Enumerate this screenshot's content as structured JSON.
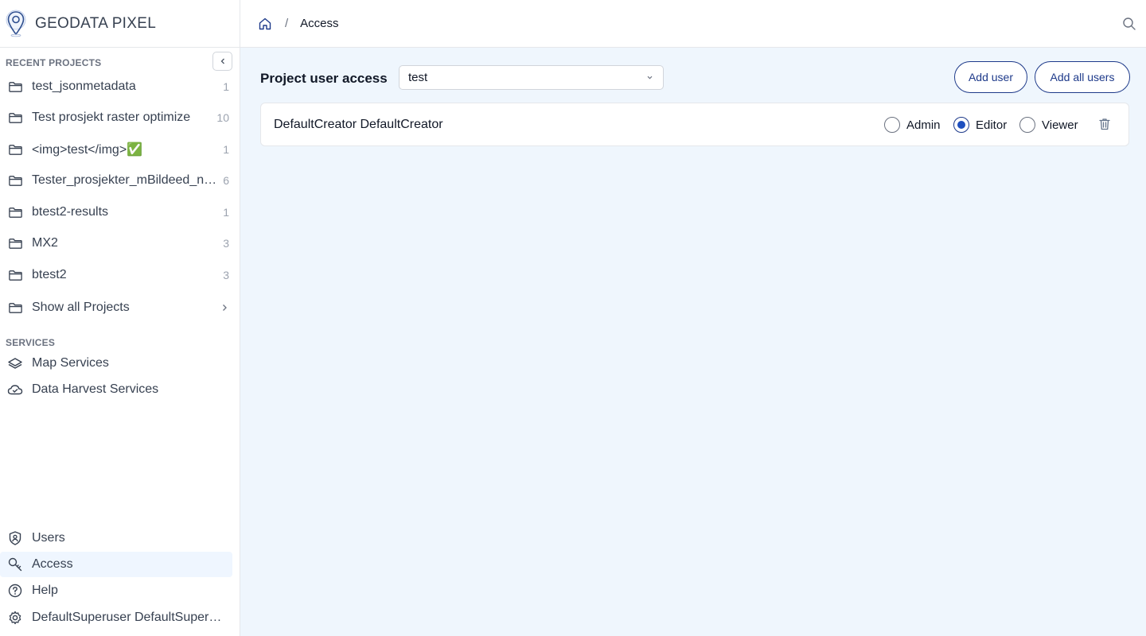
{
  "brand": {
    "name": "GEODATA PIXEL"
  },
  "sidebar": {
    "recent_label": "RECENT PROJECTS",
    "projects": [
      {
        "name": "test_jsonmetadata",
        "count": "1"
      },
      {
        "name": "Test prosjekt raster optimize",
        "count": "10"
      },
      {
        "name": "<img>test</img>✅",
        "count": "1"
      },
      {
        "name": "Tester_prosjekter_mBildeed_nummer",
        "count": "6"
      },
      {
        "name": "btest2-results",
        "count": "1"
      },
      {
        "name": "MX2",
        "count": "3"
      },
      {
        "name": "btest2",
        "count": "3"
      }
    ],
    "show_all": "Show all Projects",
    "services_label": "SERVICES",
    "services": [
      {
        "name": "Map Services",
        "icon": "layers-icon"
      },
      {
        "name": "Data Harvest Services",
        "icon": "cloud-check-icon"
      }
    ],
    "bottom": [
      {
        "name": "Users",
        "icon": "user-badge-icon"
      },
      {
        "name": "Access",
        "icon": "key-icon"
      },
      {
        "name": "Help",
        "icon": "help-icon"
      },
      {
        "name": "DefaultSuperuser DefaultSuperuser",
        "icon": "gear-icon"
      }
    ],
    "active": "Access"
  },
  "header": {
    "breadcrumb_sep": "/",
    "breadcrumb_current": "Access"
  },
  "main": {
    "title": "Project user access",
    "project_select": "test",
    "add_user": "Add user",
    "add_all_users": "Add all users",
    "users": [
      {
        "name": "DefaultCreator DefaultCreator",
        "role": "Editor"
      }
    ],
    "roles": [
      "Admin",
      "Editor",
      "Viewer"
    ]
  },
  "colors": {
    "accent": "#1e3a8a",
    "main_bg": "#eff6fd",
    "active_bg": "#eff6ff"
  }
}
